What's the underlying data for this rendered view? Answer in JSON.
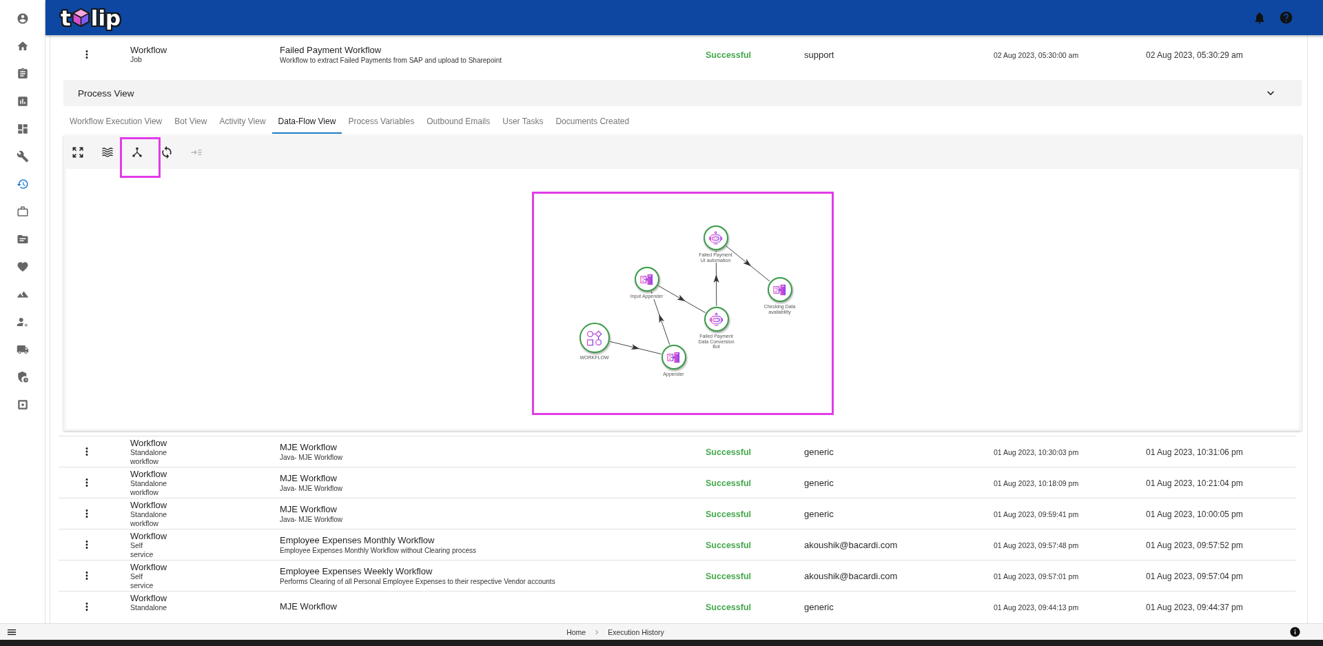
{
  "logo": {
    "text_before": "t",
    "text_after": "lip"
  },
  "sidebar": {
    "items": [
      {
        "selected": false
      },
      {
        "selected": false
      },
      {
        "selected": false
      },
      {
        "selected": false
      },
      {
        "selected": false
      },
      {
        "selected": false
      },
      {
        "selected": true
      },
      {
        "selected": false
      },
      {
        "selected": false
      },
      {
        "selected": false
      },
      {
        "selected": false
      },
      {
        "selected": false
      },
      {
        "selected": false
      },
      {
        "selected": false
      },
      {
        "selected": false
      }
    ]
  },
  "executions": [
    {
      "expanded": true,
      "column_1": {
        "title": "Workflow",
        "subtitle": "Job"
      },
      "column_2": {
        "title": "Failed Payment Workflow",
        "subtitle": "Workflow to extract Failed Payments from SAP and upload to Sharepoint"
      },
      "column_3": "Successful",
      "column_4": "support",
      "column_5": "02 Aug 2023, 05:30:00 am",
      "column_6": "02 Aug 2023, 05:30:29 am"
    },
    {
      "expanded": false,
      "column_1": {
        "title": "Workflow",
        "subtitle": "Standalone workflow"
      },
      "column_2": {
        "title": "MJE Workflow",
        "subtitle": "Java- MJE Workflow"
      },
      "column_3": "Successful",
      "column_4": "generic",
      "column_5": "01 Aug 2023, 10:30:03 pm",
      "column_6": "01 Aug 2023, 10:31:06 pm"
    },
    {
      "expanded": false,
      "column_1": {
        "title": "Workflow",
        "subtitle": "Standalone workflow"
      },
      "column_2": {
        "title": "MJE Workflow",
        "subtitle": "Java- MJE Workflow"
      },
      "column_3": "Successful",
      "column_4": "generic",
      "column_5": "01 Aug 2023, 10:18:09 pm",
      "column_6": "01 Aug 2023, 10:21:04 pm"
    },
    {
      "expanded": false,
      "column_1": {
        "title": "Workflow",
        "subtitle": "Standalone workflow"
      },
      "column_2": {
        "title": "MJE Workflow",
        "subtitle": "Java- MJE Workflow"
      },
      "column_3": "Successful",
      "column_4": "generic",
      "column_5": "01 Aug 2023, 09:59:41 pm",
      "column_6": "01 Aug 2023, 10:00:05 pm"
    },
    {
      "expanded": false,
      "column_1": {
        "title": "Workflow",
        "subtitle": "Self service"
      },
      "column_2": {
        "title": "Employee Expenses Monthly Workflow",
        "subtitle": "Employee Expenses Monthly Workflow without Clearing process"
      },
      "column_3": "Successful",
      "column_4": "akoushik@bacardi.com",
      "column_5": "01 Aug 2023, 09:57:48 pm",
      "column_6": "01 Aug 2023, 09:57:52 pm"
    },
    {
      "expanded": false,
      "column_1": {
        "title": "Workflow",
        "subtitle": "Self service"
      },
      "column_2": {
        "title": "Employee Expenses Weekly Workflow",
        "subtitle": "Performs Clearing of all Personal Employee Expenses to their respective Vendor accounts"
      },
      "column_3": "Successful",
      "column_4": "akoushik@bacardi.com",
      "column_5": "01 Aug 2023, 09:57:01 pm",
      "column_6": "01 Aug 2023, 09:57:04 pm"
    },
    {
      "expanded": false,
      "column_1": {
        "title": "Workflow",
        "subtitle": "Standalone"
      },
      "column_2": {
        "title": "MJE Workflow"
      },
      "column_3": "Successful",
      "column_4": "generic",
      "column_5": "01 Aug 2023, 09:44:13 pm",
      "column_6": "01 Aug 2023, 09:44:37 pm"
    }
  ],
  "process_view": {
    "title": "Process View",
    "tabs": [
      {
        "label": "Workflow Execution View",
        "selected": false
      },
      {
        "label": "Bot View",
        "selected": false
      },
      {
        "label": "Activity View",
        "selected": false
      },
      {
        "label": "Data-Flow View",
        "selected": true
      },
      {
        "label": "Process Variables",
        "selected": false
      },
      {
        "label": "Outbound Emails",
        "selected": false
      },
      {
        "label": "User Tasks",
        "selected": false
      },
      {
        "label": "Documents Created",
        "selected": false
      }
    ],
    "toolbar": {
      "buttons": [
        {
          "highlighted": false,
          "disabled": false
        },
        {
          "highlighted": false,
          "disabled": false
        },
        {
          "highlighted": true,
          "disabled": false
        },
        {
          "highlighted": false,
          "disabled": false
        },
        {
          "highlighted": false,
          "disabled": true
        }
      ]
    },
    "diagram": {
      "highlighted": true,
      "nodes": [
        {
          "kind": "robot",
          "label": [
            "Failed Payment",
            "UI automation"
          ]
        },
        {
          "kind": "appender",
          "label": [
            "Input Appender"
          ]
        },
        {
          "kind": "appender",
          "label": [
            "Checking Data",
            "availability"
          ]
        },
        {
          "kind": "robot",
          "label": [
            "Failed Payment",
            "Data Conversion",
            "Bot"
          ]
        },
        {
          "kind": "workflow",
          "label": [
            "WORKFLOW"
          ]
        },
        {
          "kind": "appender",
          "label": [
            "Appender"
          ]
        }
      ]
    }
  },
  "footer": {
    "breadcrumb": [
      {
        "label": "Home"
      },
      {
        "label": "Execution History"
      }
    ]
  }
}
